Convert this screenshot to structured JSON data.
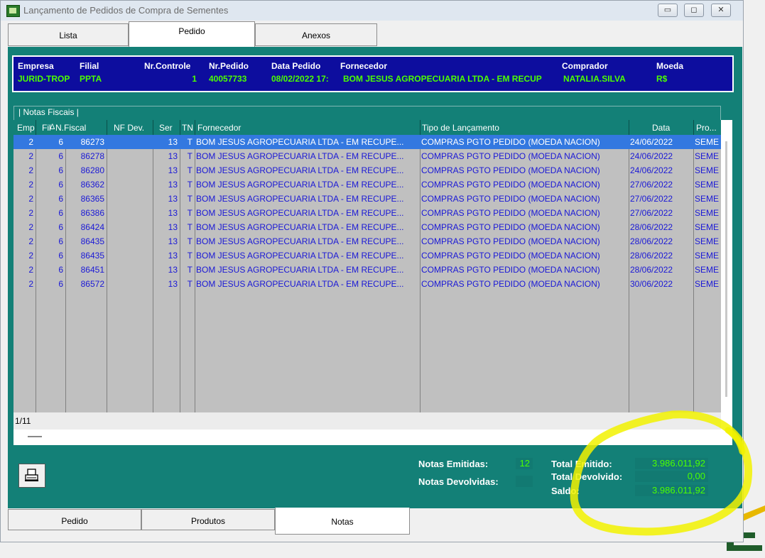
{
  "window": {
    "title": "Lançamento de Pedidos de Compra de Sementes",
    "icon": "app-icon",
    "controls": {
      "minimize": "▭",
      "maximize": "◻",
      "close": "✕"
    }
  },
  "top_tabs": [
    {
      "label": "Lista",
      "active": false
    },
    {
      "label": "Pedido",
      "active": true
    },
    {
      "label": "Anexos",
      "active": false
    }
  ],
  "order_header": {
    "labels": {
      "empresa": "Empresa",
      "filial": "Filial",
      "nr_controle": "Nr.Controle",
      "nr_pedido": "Nr.Pedido",
      "data_pedido": "Data Pedido",
      "fornecedor": "Fornecedor",
      "comprador": "Comprador",
      "moeda": "Moeda"
    },
    "values": {
      "empresa": "JURID-TROP",
      "filial": "PPTA",
      "nr_controle": "1",
      "nr_pedido": "40057733",
      "data_pedido": "08/02/2022 17:",
      "fornecedor": "BOM JESUS AGROPECUARIA LTDA - EM RECUP",
      "comprador": "NATALIA.SILVA",
      "moeda": "R$"
    }
  },
  "notas": {
    "group_label": "| Notas Fiscais |",
    "columns": {
      "emp": "Emp",
      "fil": "Fil",
      "nfiscal": "N.Fiscal",
      "nfdev": "NF Dev.",
      "ser": "Ser",
      "tn": "TN",
      "fornecedor": "Fornecedor",
      "tipo": "Tipo de Lançamento",
      "data": "Data",
      "pro": "Pro..."
    },
    "rows": [
      {
        "emp": "2",
        "fil": "6",
        "nfiscal": "86273",
        "nfdev": "",
        "ser": "13",
        "tn": "T",
        "fornecedor": "BOM JESUS AGROPECUARIA LTDA - EM RECUPE...",
        "tipo": "COMPRAS PGTO PEDIDO (MOEDA NACION)",
        "data": "24/06/2022",
        "pro": "SEME"
      },
      {
        "emp": "2",
        "fil": "6",
        "nfiscal": "86278",
        "nfdev": "",
        "ser": "13",
        "tn": "T",
        "fornecedor": "BOM JESUS AGROPECUARIA LTDA - EM RECUPE...",
        "tipo": "COMPRAS PGTO PEDIDO (MOEDA NACION)",
        "data": "24/06/2022",
        "pro": "SEME"
      },
      {
        "emp": "2",
        "fil": "6",
        "nfiscal": "86280",
        "nfdev": "",
        "ser": "13",
        "tn": "T",
        "fornecedor": "BOM JESUS AGROPECUARIA LTDA - EM RECUPE...",
        "tipo": "COMPRAS PGTO PEDIDO (MOEDA NACION)",
        "data": "24/06/2022",
        "pro": "SEME"
      },
      {
        "emp": "2",
        "fil": "6",
        "nfiscal": "86362",
        "nfdev": "",
        "ser": "13",
        "tn": "T",
        "fornecedor": "BOM JESUS AGROPECUARIA LTDA - EM RECUPE...",
        "tipo": "COMPRAS PGTO PEDIDO (MOEDA NACION)",
        "data": "27/06/2022",
        "pro": "SEME"
      },
      {
        "emp": "2",
        "fil": "6",
        "nfiscal": "86365",
        "nfdev": "",
        "ser": "13",
        "tn": "T",
        "fornecedor": "BOM JESUS AGROPECUARIA LTDA - EM RECUPE...",
        "tipo": "COMPRAS PGTO PEDIDO (MOEDA NACION)",
        "data": "27/06/2022",
        "pro": "SEME"
      },
      {
        "emp": "2",
        "fil": "6",
        "nfiscal": "86386",
        "nfdev": "",
        "ser": "13",
        "tn": "T",
        "fornecedor": "BOM JESUS AGROPECUARIA LTDA - EM RECUPE...",
        "tipo": "COMPRAS PGTO PEDIDO (MOEDA NACION)",
        "data": "27/06/2022",
        "pro": "SEME"
      },
      {
        "emp": "2",
        "fil": "6",
        "nfiscal": "86424",
        "nfdev": "",
        "ser": "13",
        "tn": "T",
        "fornecedor": "BOM JESUS AGROPECUARIA LTDA - EM RECUPE...",
        "tipo": "COMPRAS PGTO PEDIDO (MOEDA NACION)",
        "data": "28/06/2022",
        "pro": "SEME"
      },
      {
        "emp": "2",
        "fil": "6",
        "nfiscal": "86435",
        "nfdev": "",
        "ser": "13",
        "tn": "T",
        "fornecedor": "BOM JESUS AGROPECUARIA LTDA - EM RECUPE...",
        "tipo": "COMPRAS PGTO PEDIDO (MOEDA NACION)",
        "data": "28/06/2022",
        "pro": "SEME"
      },
      {
        "emp": "2",
        "fil": "6",
        "nfiscal": "86435",
        "nfdev": "",
        "ser": "13",
        "tn": "T",
        "fornecedor": "BOM JESUS AGROPECUARIA LTDA - EM RECUPE...",
        "tipo": "COMPRAS PGTO PEDIDO (MOEDA NACION)",
        "data": "28/06/2022",
        "pro": "SEME"
      },
      {
        "emp": "2",
        "fil": "6",
        "nfiscal": "86451",
        "nfdev": "",
        "ser": "13",
        "tn": "T",
        "fornecedor": "BOM JESUS AGROPECUARIA LTDA - EM RECUPE...",
        "tipo": "COMPRAS PGTO PEDIDO (MOEDA NACION)",
        "data": "28/06/2022",
        "pro": "SEME"
      },
      {
        "emp": "2",
        "fil": "6",
        "nfiscal": "86572",
        "nfdev": "",
        "ser": "13",
        "tn": "T",
        "fornecedor": "BOM JESUS AGROPECUARIA LTDA - EM RECUPE...",
        "tipo": "COMPRAS PGTO PEDIDO (MOEDA NACION)",
        "data": "30/06/2022",
        "pro": "SEME"
      }
    ],
    "record_counter": "1/11",
    "sort_indicator": "Δ"
  },
  "summary": {
    "print_icon": "printer-icon",
    "notas_emitidas_label": "Notas Emitidas:",
    "notas_emitidas_value": "12",
    "notas_devolvidas_label": "Notas Devolvidas:",
    "notas_devolvidas_value": "",
    "total_emitido_label": "Total Emitido:",
    "total_emitido_value": "3.986.011,92",
    "total_devolvido_label": "Total Devolvido:",
    "total_devolvido_value": "0,00",
    "saldo_label": "Saldo:",
    "saldo_value": "3.986.011,92"
  },
  "bottom_tabs": [
    {
      "label": "Pedido",
      "active": false
    },
    {
      "label": "Produtos",
      "active": false
    },
    {
      "label": "Notas",
      "active": true
    }
  ],
  "colors": {
    "panel": "#138077",
    "header_box": "#0d0d9e",
    "value_green": "#4cff00",
    "row_text": "#1a18d6",
    "selected_row": "#3378e0",
    "annotation": "#f2f200"
  }
}
